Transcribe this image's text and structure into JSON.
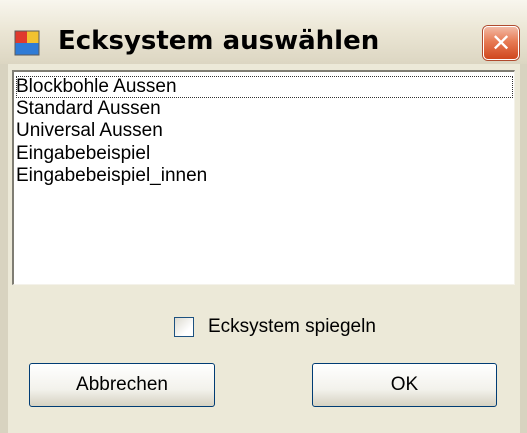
{
  "window": {
    "title": "Ecksystem auswählen",
    "close_glyph": "✕",
    "app_icon": "windows-form-icon"
  },
  "listbox": {
    "items": [
      "Blockbohle Aussen",
      "Standard Aussen",
      "Universal Aussen",
      "Eingabebeispiel",
      "Eingabebeispiel_innen"
    ],
    "focused_index": 0
  },
  "options": {
    "mirror_label": "Ecksystem spiegeln",
    "mirror_checked": false
  },
  "buttons": {
    "cancel_label": "Abbrechen",
    "ok_label": "OK"
  },
  "colors": {
    "close_button": "#d8532b",
    "dialog_face": "#ece9d8",
    "button_border": "#003c74"
  }
}
